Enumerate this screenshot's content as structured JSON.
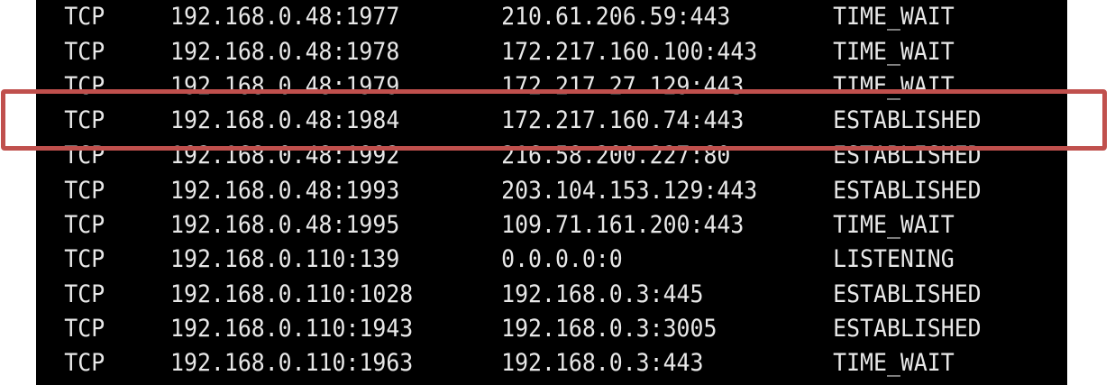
{
  "netstat_rows": [
    {
      "proto": "TCP",
      "local": "192.168.0.48:1977",
      "foreign": "210.61.206.59:443",
      "state": "TIME_WAIT"
    },
    {
      "proto": "TCP",
      "local": "192.168.0.48:1978",
      "foreign": "172.217.160.100:443",
      "state": "TIME_WAIT"
    },
    {
      "proto": "TCP",
      "local": "192.168.0.48:1979",
      "foreign": "172.217.27.129:443",
      "state": "TIME_WAIT"
    },
    {
      "proto": "TCP",
      "local": "192.168.0.48:1984",
      "foreign": "172.217.160.74:443",
      "state": "ESTABLISHED"
    },
    {
      "proto": "TCP",
      "local": "192.168.0.48:1992",
      "foreign": "216.58.200.227:80",
      "state": "ESTABLISHED"
    },
    {
      "proto": "TCP",
      "local": "192.168.0.48:1993",
      "foreign": "203.104.153.129:443",
      "state": "ESTABLISHED"
    },
    {
      "proto": "TCP",
      "local": "192.168.0.48:1995",
      "foreign": "109.71.161.200:443",
      "state": "TIME_WAIT"
    },
    {
      "proto": "TCP",
      "local": "192.168.0.110:139",
      "foreign": "0.0.0.0:0",
      "state": "LISTENING"
    },
    {
      "proto": "TCP",
      "local": "192.168.0.110:1028",
      "foreign": "192.168.0.3:445",
      "state": "ESTABLISHED"
    },
    {
      "proto": "TCP",
      "local": "192.168.0.110:1943",
      "foreign": "192.168.0.3:3005",
      "state": "ESTABLISHED"
    },
    {
      "proto": "TCP",
      "local": "192.168.0.110:1963",
      "foreign": "192.168.0.3:443",
      "state": "TIME_WAIT"
    }
  ],
  "highlighted_row": 3,
  "colors": {
    "console_background": "#000000",
    "console_text": "#e8e8e8",
    "highlight_border": "#c0504d"
  }
}
